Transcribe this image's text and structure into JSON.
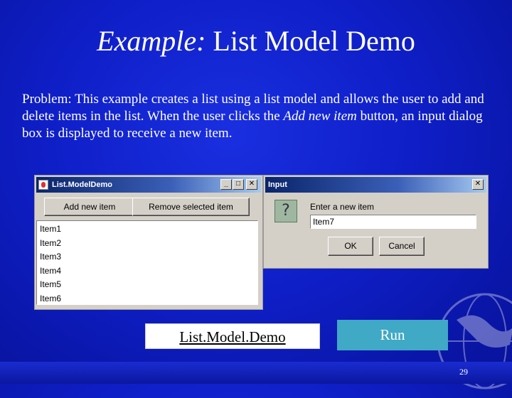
{
  "slide": {
    "title_italic": "Example:",
    "title_main": " List Model Demo",
    "problem_part1": "Problem: This example creates a list using a list model and allows the user to add and delete items in the list. When the user clicks the ",
    "problem_italic": "Add new item",
    "problem_part2": " button, an input dialog box is displayed to receive a new item.",
    "page_number": "29"
  },
  "main_window": {
    "title": "List.ModelDemo",
    "controls": {
      "minimize": "_",
      "maximize": "□",
      "close": "✕"
    },
    "add_button": "Add new item",
    "remove_button": "Remove selected item",
    "items": [
      "Item1",
      "Item2",
      "Item3",
      "Item4",
      "Item5",
      "Item6"
    ]
  },
  "input_dialog": {
    "title": "Input",
    "close": "✕",
    "icon": "question-icon",
    "icon_glyph": "?",
    "prompt": "Enter a new item",
    "value": "Item7",
    "ok_button": "OK",
    "cancel_button": "Cancel"
  },
  "links": {
    "launch": "List.Model.Demo",
    "run": "Run"
  }
}
